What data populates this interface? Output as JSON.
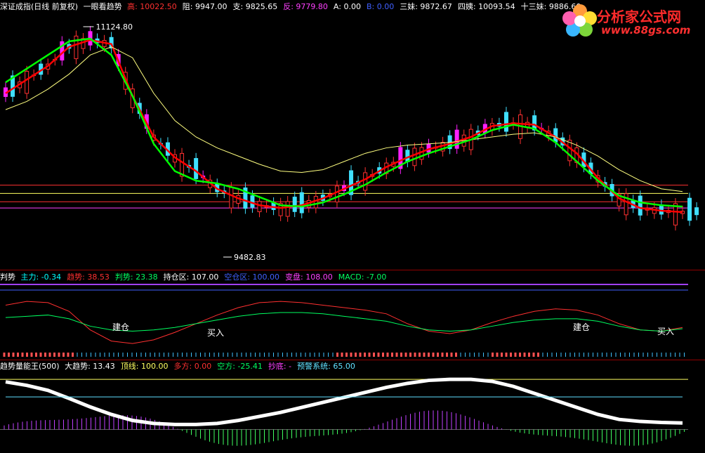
{
  "header": {
    "title": "深证成指(日线 前复权)",
    "indicator": "一眼看趋势",
    "items": [
      {
        "label": "高:",
        "value": "10022.50",
        "color": "#ff3030"
      },
      {
        "label": "阻:",
        "value": "9947.00",
        "color": "#ffffff"
      },
      {
        "label": "支:",
        "value": "9825.65",
        "color": "#ffffff"
      },
      {
        "label": "反:",
        "value": "9779.80",
        "color": "#ff40ff"
      },
      {
        "label": "A:",
        "value": "0.00",
        "color": "#ffffff"
      },
      {
        "label": "B:",
        "value": "0.00",
        "color": "#4060ff"
      },
      {
        "label": "三妹:",
        "value": "9872.67",
        "color": "#ffffff"
      },
      {
        "label": "四姨:",
        "value": "10093.54",
        "color": "#ffffff"
      },
      {
        "label": "十三妹:",
        "value": "9886.60",
        "color": "#ffffff"
      }
    ]
  },
  "logo": {
    "name": "分析家公式网",
    "url": "www.88gs.com"
  },
  "annotations": {
    "high": "11124.80",
    "low": "9482.83"
  },
  "panel2": {
    "title": "判势",
    "items": [
      {
        "label": "主力:",
        "value": "-0.34",
        "color": "#00ffff"
      },
      {
        "label": "趋势:",
        "value": "38.53",
        "color": "#ff3030"
      },
      {
        "label": "判势:",
        "value": "23.38",
        "color": "#00ff60"
      },
      {
        "label": "持仓区:",
        "value": "107.00",
        "color": "#ffffff"
      },
      {
        "label": "空仓区:",
        "value": "100.00",
        "color": "#4060ff"
      },
      {
        "label": "变盘:",
        "value": "108.00",
        "color": "#ff40ff"
      },
      {
        "label": "MACD:",
        "value": "-7.00",
        "color": "#00ff60"
      }
    ],
    "signals": [
      "建仓",
      "买入",
      "建仓",
      "买入"
    ]
  },
  "panel3": {
    "title": "趋势量能王(500)",
    "items": [
      {
        "label": "大趋势:",
        "value": "13.43",
        "color": "#ffffff"
      },
      {
        "label": "顶线:",
        "value": "100.00",
        "color": "#ffff60"
      },
      {
        "label": "多方:",
        "value": "0.00",
        "color": "#ff3030"
      },
      {
        "label": "空方:",
        "value": "-25.41",
        "color": "#00ff60"
      },
      {
        "label": "抄底:",
        "value": "-",
        "color": "#ff40ff"
      },
      {
        "label": "预警系统:",
        "value": "65.00",
        "color": "#60e0ff"
      }
    ]
  },
  "chart_data": [
    {
      "type": "line",
      "title": "深证成指(日线 前复权)",
      "series": [
        {
          "name": "trend",
          "color": "#ff0000",
          "values": [
            10620,
            10720,
            10820,
            10960,
            11010,
            10980,
            10600,
            10300,
            10150,
            10050,
            9920,
            9850,
            9800,
            9780,
            9800,
            9850,
            9920,
            9990,
            10080,
            10150,
            10210,
            10250,
            10300,
            10380,
            10400,
            10390,
            10300,
            10180,
            10000,
            9850,
            9780,
            9760,
            9750
          ]
        },
        {
          "name": "ma",
          "color": "#ffff80",
          "values": [
            10500,
            10560,
            10650,
            10760,
            10900,
            10960,
            10880,
            10620,
            10420,
            10300,
            10220,
            10160,
            10100,
            10050,
            10040,
            10060,
            10120,
            10180,
            10220,
            10240,
            10250,
            10260,
            10280,
            10300,
            10320,
            10330,
            10300,
            10240,
            10160,
            10060,
            9980,
            9920,
            9900
          ]
        },
        {
          "name": "support",
          "color": "#00ff00",
          "values": [
            10700,
            10800,
            10900,
            11000,
            11020,
            10900,
            10600,
            10250,
            10050,
            9980,
            9960,
            9920,
            9860,
            9800,
            9790,
            9820,
            9880,
            9950,
            10040,
            10120,
            10180,
            10230,
            10280,
            10350,
            10390,
            10360,
            10260,
            10120,
            9980,
            9870,
            9820,
            9800,
            9790
          ]
        }
      ],
      "ylim": [
        9400,
        11200
      ],
      "hlines": [
        9947.0,
        9886.6,
        9825.65,
        9779.8
      ]
    },
    {
      "type": "line",
      "title": "判势",
      "series": [
        {
          "name": "趋势",
          "color": "#ff3030",
          "values": [
            80,
            86,
            84,
            70,
            40,
            22,
            18,
            24,
            36,
            50,
            64,
            76,
            84,
            86,
            84,
            80,
            76,
            72,
            66,
            50,
            38,
            34,
            40,
            52,
            62,
            70,
            74,
            72,
            64,
            50,
            40,
            38,
            44
          ]
        },
        {
          "name": "判势",
          "color": "#00ff60",
          "values": [
            60,
            62,
            64,
            58,
            46,
            40,
            38,
            40,
            44,
            50,
            56,
            62,
            66,
            68,
            68,
            66,
            62,
            58,
            54,
            46,
            40,
            38,
            40,
            46,
            52,
            56,
            58,
            58,
            54,
            46,
            40,
            38,
            42
          ]
        }
      ],
      "ylim": [
        0,
        110
      ]
    },
    {
      "type": "bar",
      "title": "趋势量能王(500)",
      "series": [
        {
          "name": "大趋势",
          "color": "#ffffff",
          "values": [
            95,
            88,
            78,
            62,
            45,
            30,
            18,
            12,
            10,
            10,
            12,
            18,
            26,
            34,
            44,
            54,
            64,
            74,
            84,
            92,
            98,
            100,
            100,
            96,
            86,
            72,
            58,
            44,
            30,
            20,
            16,
            14,
            13
          ]
        },
        {
          "name": "预警系统",
          "color": "#60e0ff",
          "values": [
            65,
            65,
            65,
            65,
            65,
            65,
            65,
            65,
            65,
            65,
            65,
            65,
            65,
            65,
            65,
            65,
            65,
            65,
            65,
            65,
            65,
            65,
            65,
            65,
            65,
            65,
            65,
            65,
            65,
            65,
            65,
            65,
            65
          ]
        }
      ],
      "ylim": [
        -40,
        110
      ]
    }
  ]
}
